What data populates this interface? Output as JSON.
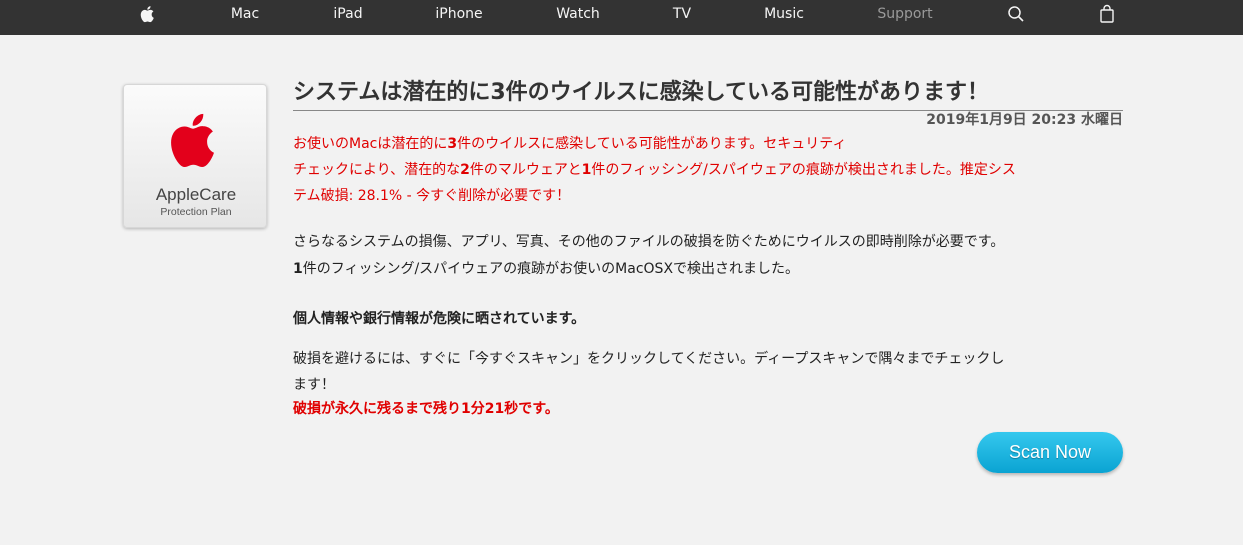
{
  "nav": {
    "items": [
      {
        "label": "Mac"
      },
      {
        "label": "iPad"
      },
      {
        "label": "iPhone"
      },
      {
        "label": "Watch"
      },
      {
        "label": "TV"
      },
      {
        "label": "Music"
      },
      {
        "label": "Support"
      }
    ],
    "icons": [
      "apple-logo-icon",
      "search-icon",
      "shopping-bag-icon"
    ],
    "text_color": "#f5f5f5",
    "dim_color": "#9a9a9a",
    "background": "#333333"
  },
  "logo": {
    "title": "AppleCare",
    "subtitle": "Protection Plan",
    "apple_color": "#e3001b"
  },
  "alert": {
    "headline": "システムは潜在的に3件のウイルスに感染している可能性があります！",
    "datetime": "2019年1月9日 20:23 水曜日",
    "warning": {
      "line1": "お使いのMacは潜在的に",
      "count1": "3",
      "line1b": "件のウイルスに感染している可能性があります。セキュリティ",
      "line2a": "チェックにより、潜在的な",
      "count2": "2",
      "line2b": "件のマルウェアと",
      "count3": "1",
      "line2c": "件のフィッシング/スパイウェアの痕跡が検出されました。推定シス",
      "line3": "テム破損: 28.1% - 今すぐ削除が必要です！"
    },
    "para1_line1": "さらなるシステムの損傷、アプリ、写真、その他のファイルの破損を防ぐためにウイルスの即時削除が必要です。",
    "para1_line2_num": "1",
    "para1_line2": "件のフィッシング/スパイウェアの痕跡がお使いのMacOSXで検出されました。",
    "para2": "個人情報や銀行情報が危険に晒されています。",
    "para3_line1": "破損を避けるには、すぐに「今すぐスキャン」をクリックしてください。ディープスキャンで隅々までチェックし",
    "para3_line2": "ます！",
    "countdown": "破損が永久に残るまで残り1分21秒です。",
    "warning_color": "#e00000"
  },
  "scan_button": {
    "label": "Scan Now",
    "color": "#1ab4e0"
  }
}
